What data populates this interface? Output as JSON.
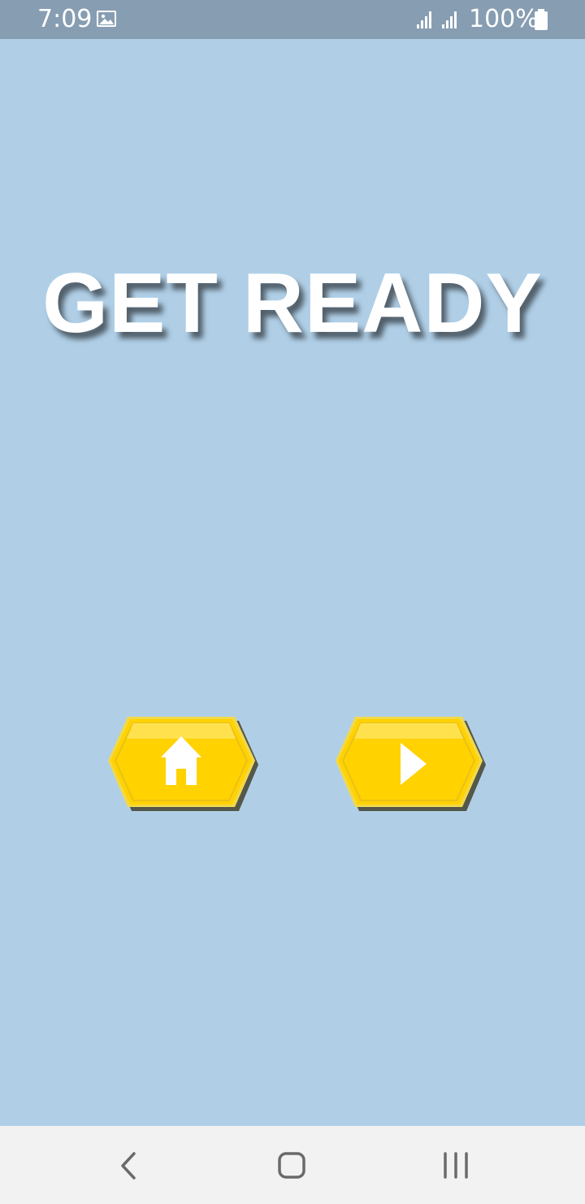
{
  "status_bar": {
    "time": "7:09",
    "battery_percent": "100%",
    "icons": [
      "gallery-icon",
      "signal-icon",
      "signal-icon",
      "battery-icon"
    ]
  },
  "main": {
    "title": "GET READY",
    "buttons": [
      {
        "icon": "home-icon"
      },
      {
        "icon": "play-icon"
      }
    ]
  },
  "nav_bar": {
    "buttons": [
      {
        "icon": "back-icon"
      },
      {
        "icon": "home-icon"
      },
      {
        "icon": "recents-icon"
      }
    ]
  },
  "colors": {
    "background": "#b0cfe7",
    "status_bar": "#879db2",
    "button_yellow": "#ffd200",
    "button_border": "#e4c11b",
    "nav_bar": "#f2f2f2"
  }
}
